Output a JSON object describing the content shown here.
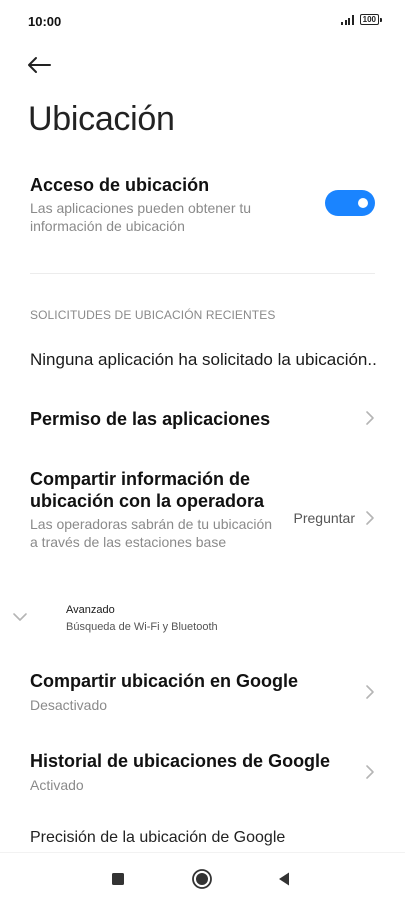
{
  "status_bar": {
    "time": "10:00",
    "battery": "100"
  },
  "header": {
    "back_icon": "arrow-left-icon",
    "title": "Ubicación"
  },
  "location_access": {
    "title": "Acceso de ubicación",
    "subtitle": "Las aplicaciones pueden obtener tu información de ubicación",
    "enabled": true,
    "toggle_color": "#1a84ff"
  },
  "recent_requests": {
    "header": "SOLICITUDES DE UBICACIÓN RECIENTES",
    "empty_text": "Ninguna aplicación ha solicitado la ubicación.."
  },
  "app_permissions": {
    "title": "Permiso de las aplicaciones"
  },
  "carrier_sharing": {
    "title": "Compartir información de ubicación con la operadora",
    "subtitle": "Las operadoras sabrán de tu ubicación a través de las estaciones base",
    "value": "Preguntar"
  },
  "advanced": {
    "title": "Avanzado",
    "subtitle": "Búsqueda de Wi-Fi y Bluetooth"
  },
  "google_location_sharing": {
    "title": "Compartir ubicación en Google",
    "status": "Desactivado"
  },
  "google_location_history": {
    "title": "Historial de ubicaciones de Google",
    "status": "Activado"
  },
  "google_location_accuracy": {
    "title": "Precisión de la ubicación de Google"
  },
  "nav_bar": {
    "icons": [
      "recents-square-icon",
      "home-circle-icon",
      "back-triangle-icon"
    ]
  }
}
